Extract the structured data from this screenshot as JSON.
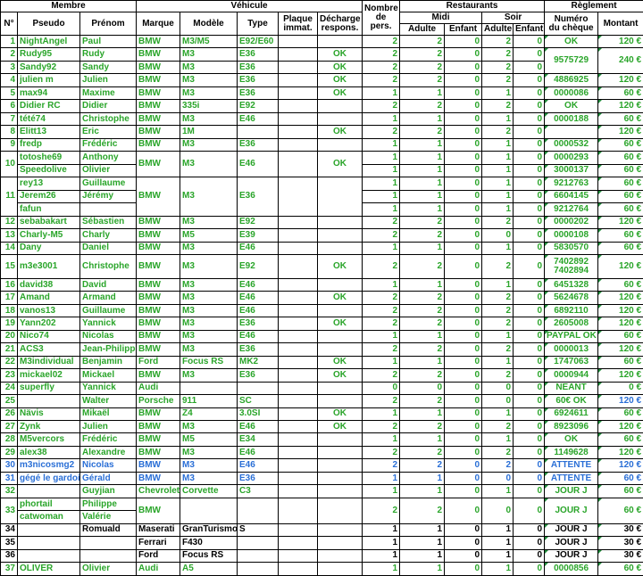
{
  "headers": {
    "membre": "Membre",
    "vehicule": "Véhicule",
    "nombre_pers": [
      "Nombre",
      "de",
      "pers."
    ],
    "restaurants": "Restaurants",
    "reglement": "Règlement",
    "midi": "Midi",
    "soir": "Soir",
    "num": "N°",
    "pseudo": "Pseudo",
    "prenom": "Prénom",
    "marque": "Marque",
    "modele": "Modèle",
    "type": "Type",
    "plaque": [
      "Plaque",
      "immat."
    ],
    "decharge": [
      "Décharge",
      "respons."
    ],
    "adulte": "Adulte",
    "enfant": "Enfant",
    "numero_cheque": [
      "Numéro",
      "du chèque"
    ],
    "montant": "Montant"
  },
  "colors": {
    "green": "#2aa52a",
    "blue": "#2a6fd6",
    "black": "#000000",
    "marker": "#1f8a3a"
  },
  "rows": [
    {
      "n": "1",
      "pseudo": "NightAngel",
      "prenom": "Paul",
      "marque": "BMW",
      "modele": "M3/M5",
      "type": "E92/E60",
      "plaque": "",
      "decharge": "",
      "pers": "2",
      "ma": "2",
      "me": "0",
      "sa": "2",
      "se": "0",
      "cheque": "OK",
      "montant": "120 €",
      "color": "g",
      "mtri": true
    },
    {
      "n": "2",
      "pseudo": "Rudy95",
      "prenom": "Rudy",
      "marque": "BMW",
      "modele": "M3",
      "type": "E36",
      "plaque": "",
      "decharge": "OK",
      "pers": "2",
      "ma": "2",
      "me": "0",
      "sa": "2",
      "se": "0",
      "cheque": "9575729",
      "montant": "240 €",
      "color": "g",
      "mtri": true,
      "span2": true
    },
    {
      "n": "3",
      "pseudo": "Sandy92",
      "prenom": "Sandy",
      "marque": "BMW",
      "modele": "M3",
      "type": "E36",
      "plaque": "",
      "decharge": "OK",
      "pers": "2",
      "ma": "2",
      "me": "0",
      "sa": "2",
      "se": "0",
      "color": "g",
      "skipCM": true
    },
    {
      "n": "4",
      "pseudo": "julien m",
      "prenom": "Julien",
      "marque": "BMW",
      "modele": "M3",
      "type": "E36",
      "plaque": "",
      "decharge": "OK",
      "pers": "2",
      "ma": "2",
      "me": "0",
      "sa": "2",
      "se": "0",
      "cheque": "4886925",
      "montant": "120 €",
      "color": "g",
      "mtri": true
    },
    {
      "n": "5",
      "pseudo": "max94",
      "prenom": "Maxime",
      "marque": "BMW",
      "modele": "M3",
      "type": "E36",
      "plaque": "",
      "decharge": "OK",
      "pers": "1",
      "ma": "1",
      "me": "0",
      "sa": "1",
      "se": "0",
      "cheque": "0000086",
      "montant": "60 €",
      "color": "g",
      "mtri": true
    },
    {
      "n": "6",
      "pseudo": "Didier RC",
      "prenom": "Didier",
      "marque": "BMW",
      "modele": "335i",
      "type": "E92",
      "plaque": "",
      "decharge": "",
      "pers": "2",
      "ma": "2",
      "me": "0",
      "sa": "2",
      "se": "0",
      "cheque": "OK",
      "montant": "120 €",
      "color": "g",
      "mtri": true
    },
    {
      "n": "7",
      "pseudo": "tété74",
      "prenom": "Christophe",
      "marque": "BMW",
      "modele": "M3",
      "type": "E46",
      "plaque": "",
      "decharge": "",
      "pers": "1",
      "ma": "1",
      "me": "0",
      "sa": "1",
      "se": "0",
      "cheque": "0000188",
      "montant": "60 €",
      "color": "g",
      "mtri": true
    },
    {
      "n": "8",
      "pseudo": "Elitt13",
      "prenom": "Eric",
      "marque": "BMW",
      "modele": "1M",
      "type": "",
      "plaque": "",
      "decharge": "OK",
      "pers": "2",
      "ma": "2",
      "me": "0",
      "sa": "2",
      "se": "0",
      "cheque": "",
      "montant": "120 €",
      "color": "g",
      "mtri": true
    },
    {
      "n": "9",
      "pseudo": "fredp",
      "prenom": "Frédéric",
      "marque": "BMW",
      "modele": "M3",
      "type": "E36",
      "plaque": "",
      "decharge": "",
      "pers": "1",
      "ma": "1",
      "me": "0",
      "sa": "1",
      "se": "0",
      "cheque": "0000532",
      "montant": "60 €",
      "color": "g",
      "mtri": true
    },
    {
      "n": "10",
      "pseudo": "totoshe69",
      "prenom": "Anthony",
      "marque": "BMW",
      "modele": "M3",
      "type": "E46",
      "plaque": "",
      "decharge": "OK",
      "pers": "1",
      "ma": "1",
      "me": "0",
      "sa": "1",
      "se": "0",
      "cheque": "0000293",
      "montant": "60 €",
      "color": "g",
      "mtri": true,
      "span2n": true
    },
    {
      "n": "",
      "pseudo": "Speedolive",
      "prenom": "Olivier",
      "marque": "",
      "modele": "",
      "type": "",
      "plaque": "",
      "decharge": "",
      "pers": "1",
      "ma": "1",
      "me": "0",
      "sa": "1",
      "se": "0",
      "cheque": "3000137",
      "montant": "60 €",
      "color": "g",
      "mtri": true,
      "dotted": true,
      "skipN": true
    },
    {
      "n": "11",
      "pseudo": "rey13",
      "prenom": "Guillaume",
      "marque": "BMW",
      "modele": "M3",
      "type": "E36",
      "plaque": "",
      "decharge": "",
      "pers": "1",
      "ma": "1",
      "me": "0",
      "sa": "1",
      "se": "0",
      "cheque": "9212763",
      "montant": "60 €",
      "color": "g",
      "mtri": true,
      "span3n": true
    },
    {
      "n": "",
      "pseudo": "Jerem26",
      "prenom": "Jérémy",
      "marque": "",
      "modele": "",
      "type": "",
      "plaque": "",
      "decharge": "",
      "pers": "1",
      "ma": "1",
      "me": "0",
      "sa": "1",
      "se": "0",
      "cheque": "6604145",
      "montant": "60 €",
      "color": "g",
      "mtri": true,
      "dotted": true,
      "skipN": true
    },
    {
      "n": "",
      "pseudo": "fafun",
      "prenom": "",
      "marque": "",
      "modele": "",
      "type": "",
      "plaque": "",
      "decharge": "",
      "pers": "1",
      "ma": "1",
      "me": "0",
      "sa": "1",
      "se": "0",
      "cheque": "9212764",
      "montant": "60 €",
      "color": "g",
      "mtri": true,
      "dotted": true,
      "skipN": true
    },
    {
      "n": "12",
      "pseudo": "sebabakart",
      "prenom": "Sébastien",
      "marque": "BMW",
      "modele": "M3",
      "type": "E92",
      "plaque": "",
      "decharge": "",
      "pers": "2",
      "ma": "2",
      "me": "0",
      "sa": "2",
      "se": "0",
      "cheque": "0000202",
      "montant": "120 €",
      "color": "g",
      "mtri": true
    },
    {
      "n": "13",
      "pseudo": "Charly-M5",
      "prenom": "Charly",
      "marque": "BMW",
      "modele": "M5",
      "type": "E39",
      "plaque": "",
      "decharge": "",
      "pers": "2",
      "ma": "2",
      "me": "0",
      "sa": "0",
      "se": "0",
      "cheque": "0000108",
      "montant": "60 €",
      "color": "g",
      "mtri": true
    },
    {
      "n": "14",
      "pseudo": "Dany",
      "prenom": "Daniel",
      "marque": "BMW",
      "modele": "M3",
      "type": "E46",
      "plaque": "",
      "decharge": "",
      "pers": "1",
      "ma": "1",
      "me": "0",
      "sa": "1",
      "se": "0",
      "cheque": "5830570",
      "montant": "60 €",
      "color": "g",
      "mtri": true
    },
    {
      "n": "15",
      "pseudo": "m3e3001",
      "prenom": "Christophe",
      "marque": "BMW",
      "modele": "M3",
      "type": "E92",
      "plaque": "",
      "decharge": "OK",
      "pers": "2",
      "ma": "2",
      "me": "0",
      "sa": "2",
      "se": "0",
      "cheque": "7402892",
      "cheque2": "7402894",
      "montant": "120 €",
      "color": "g",
      "mtri": true,
      "tall": true
    },
    {
      "n": "16",
      "pseudo": "david38",
      "prenom": "David",
      "marque": "BMW",
      "modele": "M3",
      "type": "E46",
      "plaque": "",
      "decharge": "",
      "pers": "1",
      "ma": "1",
      "me": "0",
      "sa": "1",
      "se": "0",
      "cheque": "6451328",
      "montant": "60 €",
      "color": "g",
      "mtri": true
    },
    {
      "n": "17",
      "pseudo": "Amand",
      "prenom": "Armand",
      "marque": "BMW",
      "modele": "M3",
      "type": "E46",
      "plaque": "",
      "decharge": "OK",
      "pers": "2",
      "ma": "2",
      "me": "0",
      "sa": "2",
      "se": "0",
      "cheque": "5624678",
      "montant": "120 €",
      "color": "g",
      "mtri": true
    },
    {
      "n": "18",
      "pseudo": "vanos13",
      "prenom": "Guillaume",
      "marque": "BMW",
      "modele": "M3",
      "type": "E46",
      "plaque": "",
      "decharge": "",
      "pers": "2",
      "ma": "2",
      "me": "0",
      "sa": "2",
      "se": "0",
      "cheque": "6892110",
      "montant": "120 €",
      "color": "g",
      "mtri": true
    },
    {
      "n": "19",
      "pseudo": "Yann202",
      "prenom": "Yannick",
      "marque": "BMW",
      "modele": "M3",
      "type": "E36",
      "plaque": "",
      "decharge": "OK",
      "pers": "2",
      "ma": "2",
      "me": "0",
      "sa": "2",
      "se": "0",
      "cheque": "2605008",
      "montant": "120 €",
      "color": "g",
      "mtri": true
    },
    {
      "n": "20",
      "pseudo": "Nico74",
      "prenom": "Nicolas",
      "marque": "BMW",
      "modele": "M3",
      "type": "E46",
      "plaque": "",
      "decharge": "",
      "pers": "1",
      "ma": "1",
      "me": "0",
      "sa": "1",
      "se": "0",
      "cheque": "PAYPAL OK",
      "montant": "60 €",
      "color": "g",
      "mtri": true
    },
    {
      "n": "21",
      "pseudo": "ACS3",
      "prenom": "Jean-Philippe",
      "marque": "BMW",
      "modele": "M3",
      "type": "E36",
      "plaque": "",
      "decharge": "",
      "pers": "2",
      "ma": "2",
      "me": "0",
      "sa": "2",
      "se": "0",
      "cheque": "0000013",
      "montant": "120 €",
      "color": "g",
      "mtri": true
    },
    {
      "n": "22",
      "pseudo": "M3individual",
      "prenom": "Benjamin",
      "marque": "Ford",
      "modele": "Focus RS",
      "type": "MK2",
      "plaque": "",
      "decharge": "OK",
      "pers": "1",
      "ma": "1",
      "me": "0",
      "sa": "1",
      "se": "0",
      "cheque": "1747063",
      "montant": "60 €",
      "color": "g",
      "mtri": true
    },
    {
      "n": "23",
      "pseudo": "mickael02",
      "prenom": "Mickael",
      "marque": "BMW",
      "modele": "M3",
      "type": "E36",
      "plaque": "",
      "decharge": "OK",
      "pers": "2",
      "ma": "2",
      "me": "0",
      "sa": "2",
      "se": "0",
      "cheque": "0000944",
      "montant": "120 €",
      "color": "g",
      "mtri": true
    },
    {
      "n": "24",
      "pseudo": "superfly",
      "prenom": "Yannick",
      "marque": "Audi",
      "modele": "",
      "type": "",
      "plaque": "",
      "decharge": "",
      "pers": "0",
      "ma": "0",
      "me": "0",
      "sa": "0",
      "se": "0",
      "cheque": "NEANT",
      "montant": "0 €",
      "color": "g",
      "mtri": true
    },
    {
      "n": "25",
      "pseudo": "",
      "prenom": "Walter",
      "marque": "Porsche",
      "modele": "911",
      "type": "SC",
      "plaque": "",
      "decharge": "",
      "pers": "2",
      "ma": "2",
      "me": "0",
      "sa": "0",
      "se": "0",
      "cheque": "60€ OK",
      "montant": "120 €",
      "color": "g",
      "mtri": true,
      "mblue": true
    },
    {
      "n": "26",
      "pseudo": "Nävis",
      "prenom": "Mikaël",
      "marque": "BMW",
      "modele": "Z4",
      "type": "3.0SI",
      "plaque": "",
      "decharge": "OK",
      "pers": "1",
      "ma": "1",
      "me": "0",
      "sa": "1",
      "se": "0",
      "cheque": "6924611",
      "montant": "60 €",
      "color": "g",
      "mtri": true
    },
    {
      "n": "27",
      "pseudo": "Zynk",
      "prenom": "Julien",
      "marque": "BMW",
      "modele": "M3",
      "type": "E46",
      "plaque": "",
      "decharge": "OK",
      "pers": "2",
      "ma": "2",
      "me": "0",
      "sa": "2",
      "se": "0",
      "cheque": "8923096",
      "montant": "120 €",
      "color": "g",
      "mtri": true
    },
    {
      "n": "28",
      "pseudo": "M5vercors",
      "prenom": "Frédéric",
      "marque": "BMW",
      "modele": "M5",
      "type": "E34",
      "plaque": "",
      "decharge": "",
      "pers": "1",
      "ma": "1",
      "me": "0",
      "sa": "1",
      "se": "0",
      "cheque": "OK",
      "montant": "60 €",
      "color": "g",
      "mtri": true
    },
    {
      "n": "29",
      "pseudo": "alex38",
      "prenom": "Alexandre",
      "marque": "BMW",
      "modele": "M3",
      "type": "E46",
      "plaque": "",
      "decharge": "",
      "pers": "2",
      "ma": "2",
      "me": "0",
      "sa": "2",
      "se": "0",
      "cheque": "1149628",
      "montant": "120 €",
      "color": "g",
      "mtri": true
    },
    {
      "n": "30",
      "pseudo": "m3nicosmg2",
      "prenom": "Nicolas",
      "marque": "BMW",
      "modele": "M3",
      "type": "E46",
      "plaque": "",
      "decharge": "",
      "pers": "2",
      "ma": "2",
      "me": "0",
      "sa": "2",
      "se": "0",
      "cheque": "ATTENTE",
      "montant": "120 €",
      "color": "b",
      "mtri": true
    },
    {
      "n": "31",
      "pseudo": "gégé le gardois",
      "prenom": "Gérald",
      "marque": "BMW",
      "modele": "M3",
      "type": "E36",
      "plaque": "",
      "decharge": "",
      "pers": "1",
      "ma": "1",
      "me": "0",
      "sa": "0",
      "se": "0",
      "cheque": "ATTENTE",
      "montant": "60 €",
      "color": "b",
      "mtri": true
    },
    {
      "n": "32",
      "pseudo": "",
      "prenom": "Guyjian",
      "marque": "Chevrolet",
      "modele": "Corvette",
      "type": "C3",
      "plaque": "",
      "decharge": "",
      "pers": "1",
      "ma": "1",
      "me": "0",
      "sa": "1",
      "se": "0",
      "cheque": "JOUR J",
      "montant": "60 €",
      "color": "g",
      "mtri": true
    },
    {
      "n": "33",
      "pseudo": "phortail",
      "prenom": "Philippe",
      "marque": "BMW",
      "modele": "",
      "type": "",
      "plaque": "",
      "decharge": "",
      "pers": "2",
      "ma": "2",
      "me": "0",
      "sa": "0",
      "se": "0",
      "cheque": "JOUR J",
      "montant": "60 €",
      "color": "g",
      "mtri": true,
      "span2b": true
    },
    {
      "n": "",
      "pseudo": "catwoman",
      "prenom": "Valérie",
      "color": "g",
      "dotted": true,
      "sub33": true
    },
    {
      "n": "34",
      "pseudo": "",
      "prenom": "Romuald",
      "marque": "Maserati",
      "modele": "GranTurismo",
      "type": "S",
      "plaque": "",
      "decharge": "",
      "pers": "1",
      "ma": "1",
      "me": "0",
      "sa": "1",
      "se": "0",
      "cheque": "JOUR J",
      "montant": "30 €",
      "color": "k",
      "mtri": true
    },
    {
      "n": "35",
      "pseudo": "",
      "prenom": "",
      "marque": "Ferrari",
      "modele": "F430",
      "type": "",
      "plaque": "",
      "decharge": "",
      "pers": "1",
      "ma": "1",
      "me": "0",
      "sa": "1",
      "se": "0",
      "cheque": "JOUR J",
      "montant": "30 €",
      "color": "k",
      "mtri": true
    },
    {
      "n": "36",
      "pseudo": "",
      "prenom": "",
      "marque": "Ford",
      "modele": "Focus RS",
      "type": "",
      "plaque": "",
      "decharge": "",
      "pers": "1",
      "ma": "1",
      "me": "0",
      "sa": "1",
      "se": "0",
      "cheque": "JOUR J",
      "montant": "30 €",
      "color": "k",
      "mtri": true
    },
    {
      "n": "37",
      "pseudo": "OLIVER",
      "prenom": "Olivier",
      "marque": "Audi",
      "modele": "A5",
      "type": "",
      "plaque": "",
      "decharge": "",
      "pers": "1",
      "ma": "1",
      "me": "0",
      "sa": "1",
      "se": "0",
      "cheque": "0000856",
      "montant": "60 €",
      "color": "g",
      "mtri": true
    }
  ]
}
